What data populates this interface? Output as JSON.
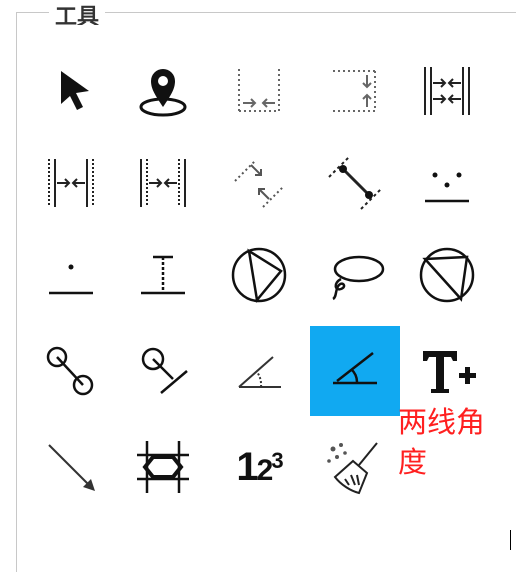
{
  "panel": {
    "title": "工具"
  },
  "tools": [
    {
      "id": "select",
      "icon": "arrow-cursor-icon"
    },
    {
      "id": "point",
      "icon": "map-pin-icon"
    },
    {
      "id": "horizontal-distance",
      "icon": "horizontal-distance-icon"
    },
    {
      "id": "vertical-distance",
      "icon": "vertical-distance-icon"
    },
    {
      "id": "gap-distance",
      "icon": "gap-distance-icon"
    },
    {
      "id": "width-measure",
      "icon": "width-measure-icon"
    },
    {
      "id": "width-measure-2",
      "icon": "width-measure-alt-icon"
    },
    {
      "id": "slanted-distance",
      "icon": "slanted-distance-icon"
    },
    {
      "id": "point-to-point",
      "icon": "point-to-point-icon"
    },
    {
      "id": "points-to-line",
      "icon": "points-to-line-icon"
    },
    {
      "id": "point-to-line",
      "icon": "point-to-line-icon"
    },
    {
      "id": "height-measure",
      "icon": "height-measure-icon"
    },
    {
      "id": "circle-3pt",
      "icon": "circle-three-point-icon"
    },
    {
      "id": "lasso",
      "icon": "lasso-icon"
    },
    {
      "id": "circle-fit",
      "icon": "circle-fit-icon"
    },
    {
      "id": "circle-to-circle",
      "icon": "circle-to-circle-icon"
    },
    {
      "id": "circle-to-line",
      "icon": "circle-to-line-icon"
    },
    {
      "id": "angle",
      "icon": "angle-icon"
    },
    {
      "id": "two-line-angle",
      "icon": "two-line-angle-icon",
      "selected": true
    },
    {
      "id": "text-add",
      "icon": "text-add-icon"
    },
    {
      "id": "arrow-line",
      "icon": "arrow-line-icon"
    },
    {
      "id": "rectangle-shape",
      "icon": "crossed-rectangle-icon"
    },
    {
      "id": "numbering",
      "icon": "numbering-icon",
      "label": "123"
    },
    {
      "id": "clear",
      "icon": "broom-icon"
    }
  ],
  "tooltip": {
    "text": "两线角度"
  },
  "colors": {
    "selected": "#11a9f1",
    "tooltip": "#ff2020"
  }
}
